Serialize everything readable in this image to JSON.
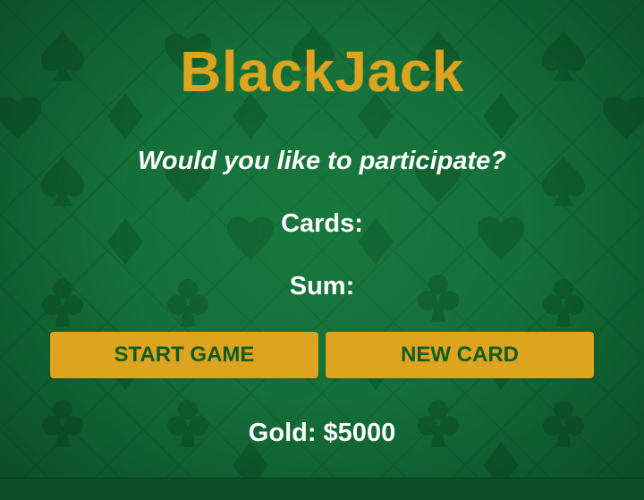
{
  "game": {
    "title": "BlackJack",
    "message": "Would you like to participate?",
    "cards_label": "Cards:",
    "sum_label": "Sum:",
    "gold_label": "Gold: $5000"
  },
  "buttons": {
    "start": "START GAME",
    "new_card": "NEW CARD"
  },
  "colors": {
    "felt": "#136b35",
    "gold": "#dfa41f",
    "button_text": "#0f5c22",
    "text": "#ffffff"
  },
  "background_icons": [
    "spade-icon",
    "heart-icon",
    "diamond-icon",
    "club-icon"
  ]
}
